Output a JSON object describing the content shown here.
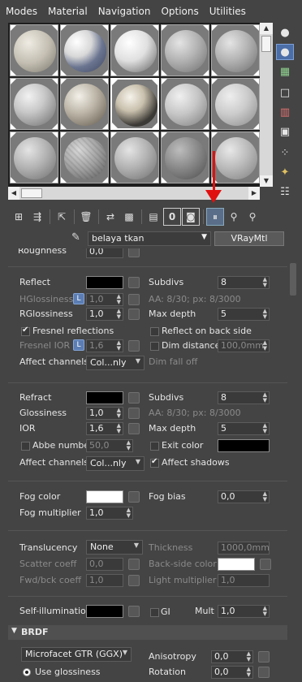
{
  "menu": [
    "Modes",
    "Material",
    "Navigation",
    "Options",
    "Utilities"
  ],
  "material": {
    "name": "belaya tkan",
    "type": "VRayMtl"
  },
  "params": {
    "roughness_label": "Roughness",
    "roughness_value": "0,0",
    "reflect_label": "Reflect",
    "reflect_color": "#000000",
    "subdivs_label": "Subdivs",
    "refl_subdivs": "8",
    "hglossiness_label": "HGlossiness",
    "hglossiness_value": "1,0",
    "lock_label": "L",
    "aa_refl": "AA: 8/30; px: 8/3000",
    "rglossiness_label": "RGlossiness",
    "rglossiness_value": "1,0",
    "max_depth_label": "Max depth",
    "refl_max_depth": "5",
    "fresnel_label": "Fresnel reflections",
    "reflect_back_label": "Reflect on back side",
    "fresnel_ior_label": "Fresnel IOR",
    "fresnel_ior_value": "1,6",
    "dim_distance_label": "Dim distance",
    "dim_distance_value": "100,0mm",
    "affect_channels_label": "Affect channels",
    "affect_channels_value": "Col...nly",
    "dim_falloff_label": "Dim fall off",
    "refract_label": "Refract",
    "refract_color": "#000000",
    "refr_subdivs": "8",
    "glossiness_label": "Glossiness",
    "glossiness_value": "1,0",
    "aa_refr": "AA: 8/30; px: 8/3000",
    "ior_label": "IOR",
    "ior_value": "1,6",
    "refr_max_depth": "5",
    "abbe_label": "Abbe number",
    "abbe_value": "50,0",
    "exit_color_label": "Exit color",
    "exit_color": "#000000",
    "refr_affect_value": "Col...nly",
    "affect_shadows_label": "Affect shadows",
    "fog_color_label": "Fog color",
    "fog_color": "#ffffff",
    "fog_bias_label": "Fog bias",
    "fog_bias_value": "0,0",
    "fog_multiplier_label": "Fog multiplier",
    "fog_multiplier_value": "1,0",
    "translucency_label": "Translucency",
    "translucency_value": "None",
    "thickness_label": "Thickness",
    "thickness_value": "1000,0mm",
    "scatter_label": "Scatter coeff",
    "scatter_value": "0,0",
    "backside_label": "Back-side color",
    "backside_color": "#ffffff",
    "fwd_label": "Fwd/bck coeff",
    "fwd_value": "1,0",
    "light_mult_label": "Light multiplier",
    "light_mult_value": "1,0",
    "self_illum_label": "Self-illumination",
    "self_illum_color": "#000000",
    "gi_label": "GI",
    "mult_label": "Mult",
    "mult_value": "1,0"
  },
  "brdf": {
    "title": "BRDF",
    "type_value": "Microfacet GTR (GGX)",
    "anisotropy_label": "Anisotropy",
    "anisotropy_value": "0,0",
    "use_glossiness_label": "Use glossiness",
    "rotation_label": "Rotation",
    "rotation_value": "0,0"
  },
  "colors": {
    "annotation_arrow": "#e01010",
    "background": "#444444"
  }
}
